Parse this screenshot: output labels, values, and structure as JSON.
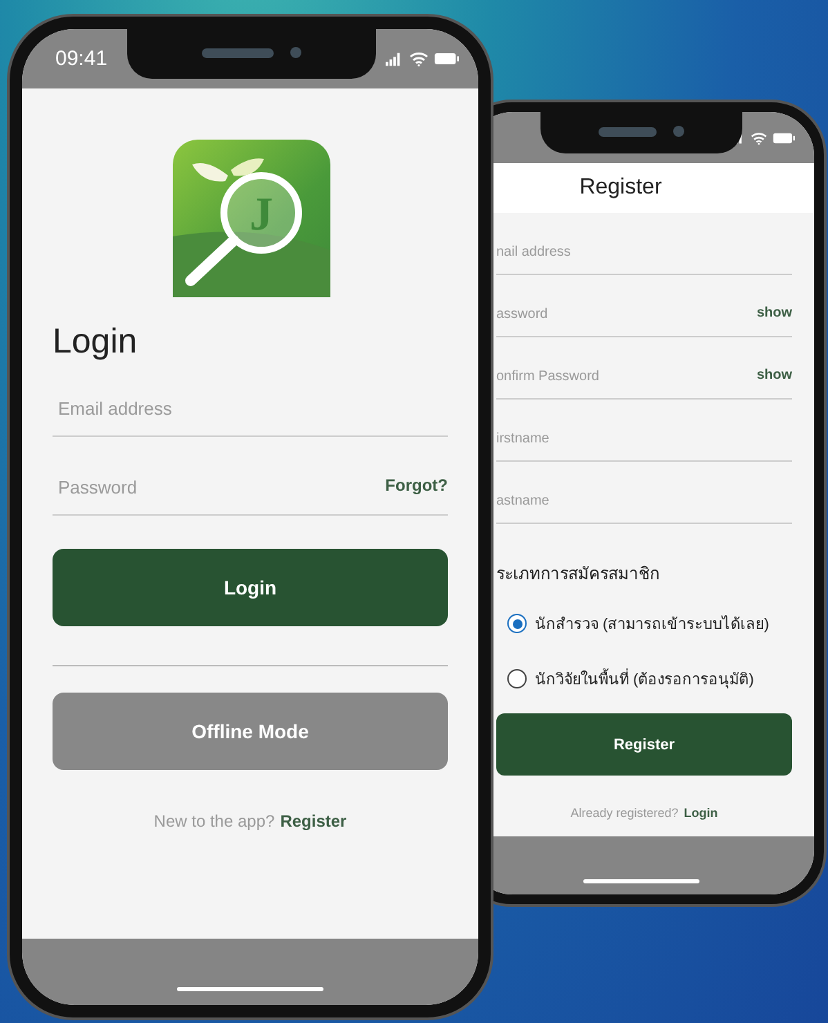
{
  "front_phone": {
    "status_bar": {
      "time": "09:41"
    },
    "logo_letter": "J",
    "title": "Login",
    "fields": [
      {
        "placeholder": "Email address"
      },
      {
        "placeholder": "Password",
        "action": "Forgot?"
      }
    ],
    "login_button": "Login",
    "offline_button": "Offline Mode",
    "footer": {
      "text": "New to the app?",
      "link": "Register"
    }
  },
  "back_phone": {
    "title": "Register",
    "fields": [
      {
        "placeholder": "nail address"
      },
      {
        "placeholder": "assword",
        "action": "show"
      },
      {
        "placeholder": "onfirm Password",
        "action": "show"
      },
      {
        "placeholder": "irstname"
      },
      {
        "placeholder": "astname"
      }
    ],
    "member_type": {
      "label": "ระเภทการสมัครสมาชิก",
      "options": [
        {
          "label": "นักสำรวจ (สามารถเข้าระบบได้เลย)",
          "selected": true
        },
        {
          "label": "นักวิจัยในพื้นที่ (ต้องรอการอนุมัติ)",
          "selected": false
        }
      ]
    },
    "register_button": "Register",
    "footer": {
      "text": "Already registered?",
      "link": "Login"
    }
  }
}
